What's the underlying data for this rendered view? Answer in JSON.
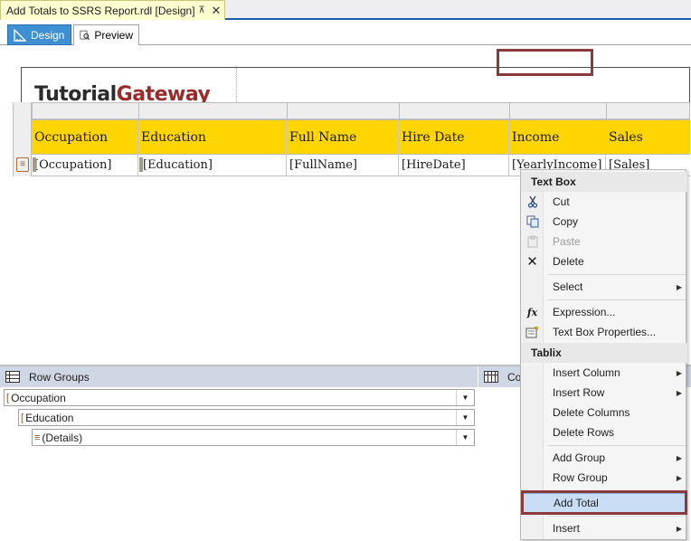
{
  "document_tab": {
    "title": "Add Totals to SSRS Report.rdl [Design]",
    "pin_glyph": "⊼",
    "close_glyph": "✕"
  },
  "view_tabs": {
    "design": "Design",
    "preview": "Preview"
  },
  "logo": {
    "part1": "Tutorial",
    "part2": "Gateway"
  },
  "tablix": {
    "headers": [
      "Occupation",
      "Education",
      "Full Name",
      "Hire Date",
      "Income",
      "Sales"
    ],
    "details": [
      "[Occupation]",
      "[Education]",
      "[FullName]",
      "[HireDate]",
      "[YearlyIncome]",
      "[Sales]"
    ]
  },
  "panes": {
    "row_groups_title": "Row Groups",
    "column_groups_title": "Co",
    "row_groups": [
      "Occupation",
      "Education",
      "(Details)"
    ],
    "group_glyph": "[",
    "details_glyph": "≡"
  },
  "context_menu": {
    "section_textbox": "Text Box",
    "cut": "Cut",
    "copy": "Copy",
    "paste": "Paste",
    "delete": "Delete",
    "select": "Select",
    "expression": "Expression...",
    "textbox_properties": "Text Box Properties...",
    "section_tablix": "Tablix",
    "insert_column": "Insert Column",
    "insert_row": "Insert Row",
    "delete_columns": "Delete Columns",
    "delete_rows": "Delete Rows",
    "add_group": "Add Group",
    "row_group": "Row Group",
    "add_total": "Add Total",
    "insert": "Insert",
    "submenu_arrow": "▶",
    "fx_glyph": "fx",
    "delete_glyph": "✕"
  },
  "colors": {
    "header_fill": "#ffd500",
    "accent_blue": "#3f8fd4",
    "selection_border": "#8a3a3a",
    "logo_red": "#9b2b2b"
  }
}
